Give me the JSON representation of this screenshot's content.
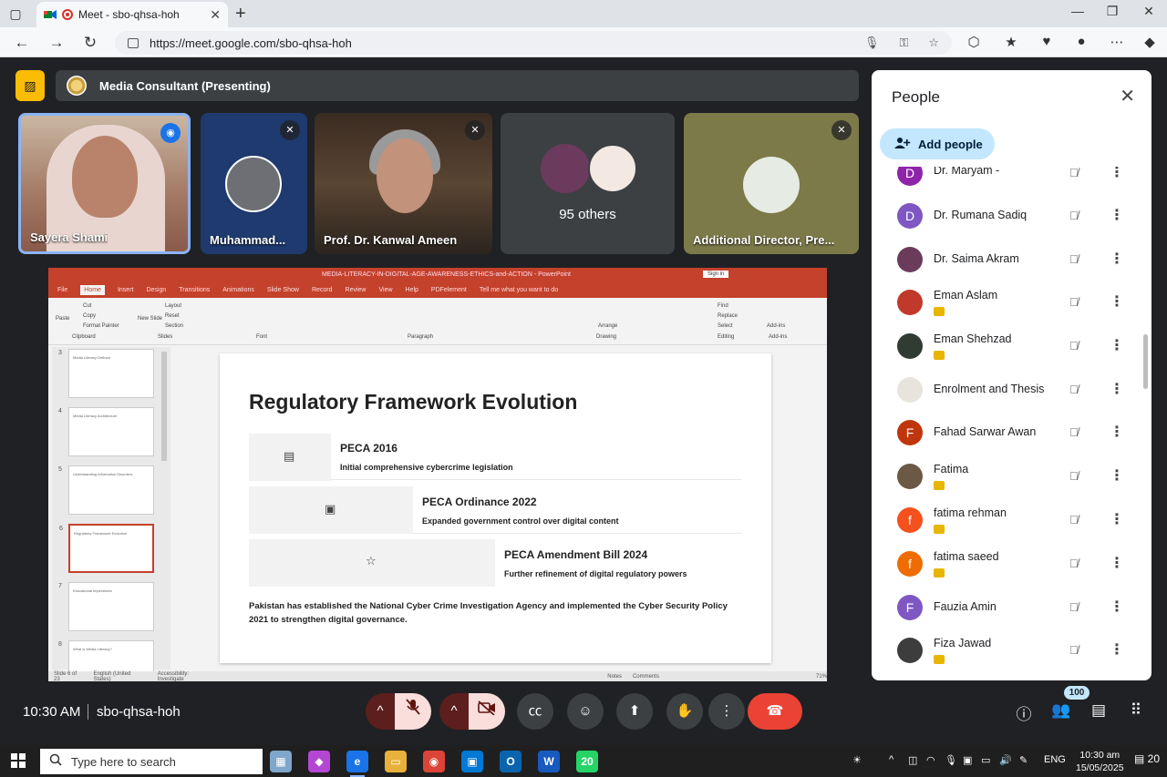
{
  "browser": {
    "tab_title": "Meet - sbo-qhsa-hoh",
    "url": "https://meet.google.com/sbo-qhsa-hoh",
    "new_tab": "+",
    "minimize": "—",
    "maximize": "❐",
    "close": "✕"
  },
  "meeting": {
    "presenting": "Media Consultant (Presenting)",
    "time": "10:30 AM",
    "code": "sbo-qhsa-hoh"
  },
  "tiles": [
    {
      "name": "Sayera Shami"
    },
    {
      "name": "Muhammad..."
    },
    {
      "name": "Prof. Dr. Kanwal Ameen"
    },
    {
      "others": "95 others"
    },
    {
      "name": "Additional Director, Pre..."
    }
  ],
  "ppt": {
    "window_title": "MEDIA-LITERACY-IN-DIGITAL-AGE-AWARENESS-ETHICS-and-ACTION - PowerPoint",
    "sign_in": "Sign in",
    "menus": [
      "File",
      "Home",
      "Insert",
      "Design",
      "Transitions",
      "Animations",
      "Slide Show",
      "Record",
      "Review",
      "View",
      "Help",
      "PDFelement",
      "Tell me what you want to do"
    ],
    "ribbon_groups": [
      "Clipboard",
      "Slides",
      "Font",
      "Paragraph",
      "Drawing",
      "Editing",
      "Add-ins"
    ],
    "ribbon_items": {
      "paste": "Paste",
      "cut": "Cut",
      "copy": "Copy",
      "format_painter": "Format Painter",
      "new_slide": "New Slide",
      "layout": "Layout",
      "reset": "Reset",
      "section": "Section",
      "arrange": "Arrange",
      "find": "Find",
      "replace": "Replace",
      "select": "Select",
      "addins": "Add-ins"
    },
    "thumbs": [
      {
        "n": "3",
        "title": "Media Literacy Defined"
      },
      {
        "n": "4",
        "title": "Media Literacy Architecture"
      },
      {
        "n": "5",
        "title": "Understanding Information Disorders"
      },
      {
        "n": "6",
        "title": "Regulatory Framework Evolution"
      },
      {
        "n": "7",
        "title": "Educational Imperatives"
      },
      {
        "n": "8",
        "title": "What is Media Literacy?"
      }
    ],
    "status": {
      "slide": "Slide 6 of 23",
      "lang": "English (United States)",
      "access": "Accessibility: Investigate",
      "notes": "Notes",
      "comments": "Comments",
      "zoom": "71%"
    }
  },
  "slide": {
    "title": "Regulatory Framework Evolution",
    "steps": [
      {
        "title": "PECA 2016",
        "desc": "Initial comprehensive cybercrime legislation",
        "icon": "document-icon"
      },
      {
        "title": "PECA Ordinance 2022",
        "desc": "Expanded government control over digital content",
        "icon": "stamp-icon"
      },
      {
        "title": "PECA Amendment Bill 2024",
        "desc": "Further refinement of digital regulatory powers",
        "icon": "star-icon"
      }
    ],
    "summary": "Pakistan has established the National Cyber Crime Investigation Agency and implemented the Cyber Security Policy 2021 to strengthen digital governance."
  },
  "people": {
    "title": "People",
    "add_label": "Add people",
    "count": "100",
    "list": [
      {
        "name": "Dr. Maryam -",
        "initial": "D",
        "color": "#8e24aa",
        "tag": false
      },
      {
        "name": "Dr. Rumana Sadiq",
        "initial": "D",
        "color": "#7e57c2",
        "tag": false
      },
      {
        "name": "Dr. Saima Akram",
        "initial": "",
        "color": "#6a3b5a",
        "tag": false
      },
      {
        "name": "Eman Aslam",
        "initial": "",
        "color": "#c0392b",
        "tag": true
      },
      {
        "name": "Eman Shehzad",
        "initial": "",
        "color": "#2f3b33",
        "tag": true
      },
      {
        "name": "Enrolment and Thesis",
        "initial": "",
        "color": "#e7e4dd",
        "tag": false
      },
      {
        "name": "Fahad Sarwar Awan",
        "initial": "F",
        "color": "#bf360c",
        "tag": false
      },
      {
        "name": "Fatima",
        "initial": "",
        "color": "#6b5845",
        "tag": true
      },
      {
        "name": "fatima rehman",
        "initial": "f",
        "color": "#f4511e",
        "tag": true
      },
      {
        "name": "fatima saeed",
        "initial": "f",
        "color": "#ef6c00",
        "tag": true
      },
      {
        "name": "Fauzia Amin",
        "initial": "F",
        "color": "#7e57c2",
        "tag": false
      },
      {
        "name": "Fiza Jawad",
        "initial": "",
        "color": "#3d3d3d",
        "tag": true
      }
    ]
  },
  "taskbar": {
    "search_placeholder": "Type here to search",
    "lang": "ENG",
    "time": "10:30 am",
    "date": "15/05/2025",
    "whatsapp_badge": "20",
    "notif_count": "20"
  }
}
